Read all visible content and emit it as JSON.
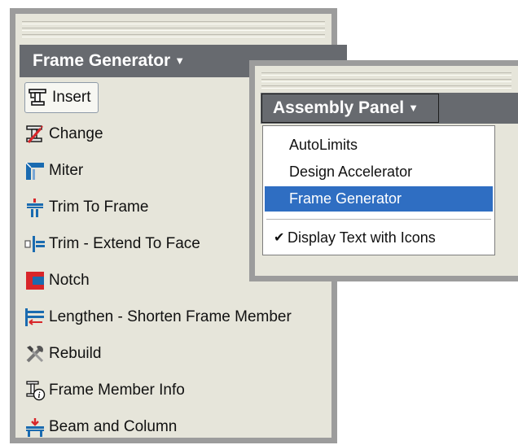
{
  "frame_generator_panel": {
    "title": "Frame Generator",
    "caret": "▼",
    "tools": [
      {
        "label": "Insert",
        "icon": "insert-frame-icon",
        "active": true
      },
      {
        "label": "Change",
        "icon": "change-frame-icon"
      },
      {
        "label": "Miter",
        "icon": "miter-icon"
      },
      {
        "label": "Trim To Frame",
        "icon": "trim-to-frame-icon"
      },
      {
        "label": "Trim - Extend To Face",
        "icon": "trim-extend-icon"
      },
      {
        "label": "Notch",
        "icon": "notch-icon"
      },
      {
        "label": "Lengthen - Shorten Frame Member",
        "icon": "lengthen-shorten-icon"
      },
      {
        "label": "Rebuild",
        "icon": "rebuild-icon"
      },
      {
        "label": "Frame Member Info",
        "icon": "frame-member-info-icon"
      },
      {
        "label": "Beam and Column",
        "icon": "beam-column-icon"
      }
    ]
  },
  "assembly_panel": {
    "title": "Assembly Panel",
    "caret": "▼",
    "menu_items": [
      {
        "label": "AutoLimits"
      },
      {
        "label": "Design Accelerator"
      },
      {
        "label": "Frame Generator",
        "selected": true
      }
    ],
    "option": {
      "label": "Display Text with Icons",
      "checked": true,
      "check_glyph": "✔"
    }
  },
  "colors": {
    "panel_bg": "#e6e5da",
    "header_bg": "#676a6f",
    "border_gray": "#9c9c9c",
    "selection_blue": "#2f6ec2",
    "icon_blue": "#1a6bb0",
    "icon_red": "#d8262a"
  }
}
